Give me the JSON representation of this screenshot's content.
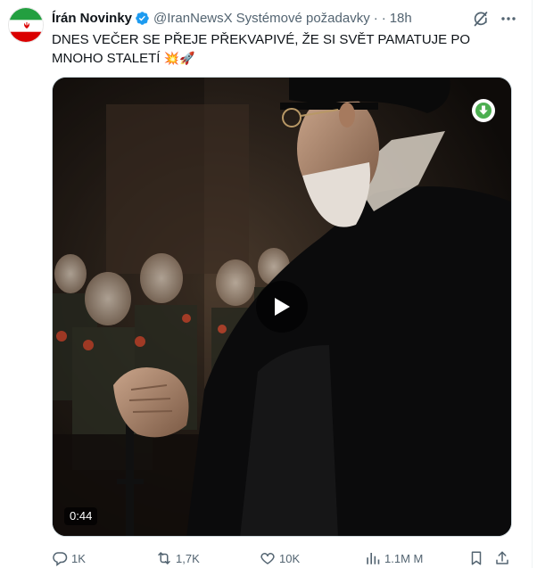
{
  "tweet": {
    "author_name": "Írán Novinky",
    "handle": "@IranNewsX",
    "subscription_label": "Systémové požadavky",
    "dot": "·",
    "time": "18h",
    "text": "DNES VEČER SE PŘEJE PŘEKVAPIVÉ, ŽE SI SVĚT PAMATUJE PO MNOHO STALETÍ",
    "emojis": "💥🚀",
    "media": {
      "duration": "0:44"
    },
    "stats": {
      "replies": "1K",
      "reposts": "1,7K",
      "likes": "10K",
      "views": "1.1M M"
    }
  },
  "icons": {
    "avatar": "iran-flag-icon",
    "verified": "verified-badge-icon",
    "grok": "grok-icon",
    "more": "more-icon",
    "download": "download-icon",
    "play": "play-icon",
    "reply": "reply-icon",
    "repost": "repost-icon",
    "like": "heart-icon",
    "views": "views-icon",
    "bookmark": "bookmark-icon",
    "share": "share-icon"
  },
  "colors": {
    "text": "#0f1419",
    "secondary": "#536471",
    "verified": "#1d9bf0",
    "flag_green": "#239f40",
    "flag_red": "#da0000",
    "download_green": "#4caf50"
  }
}
